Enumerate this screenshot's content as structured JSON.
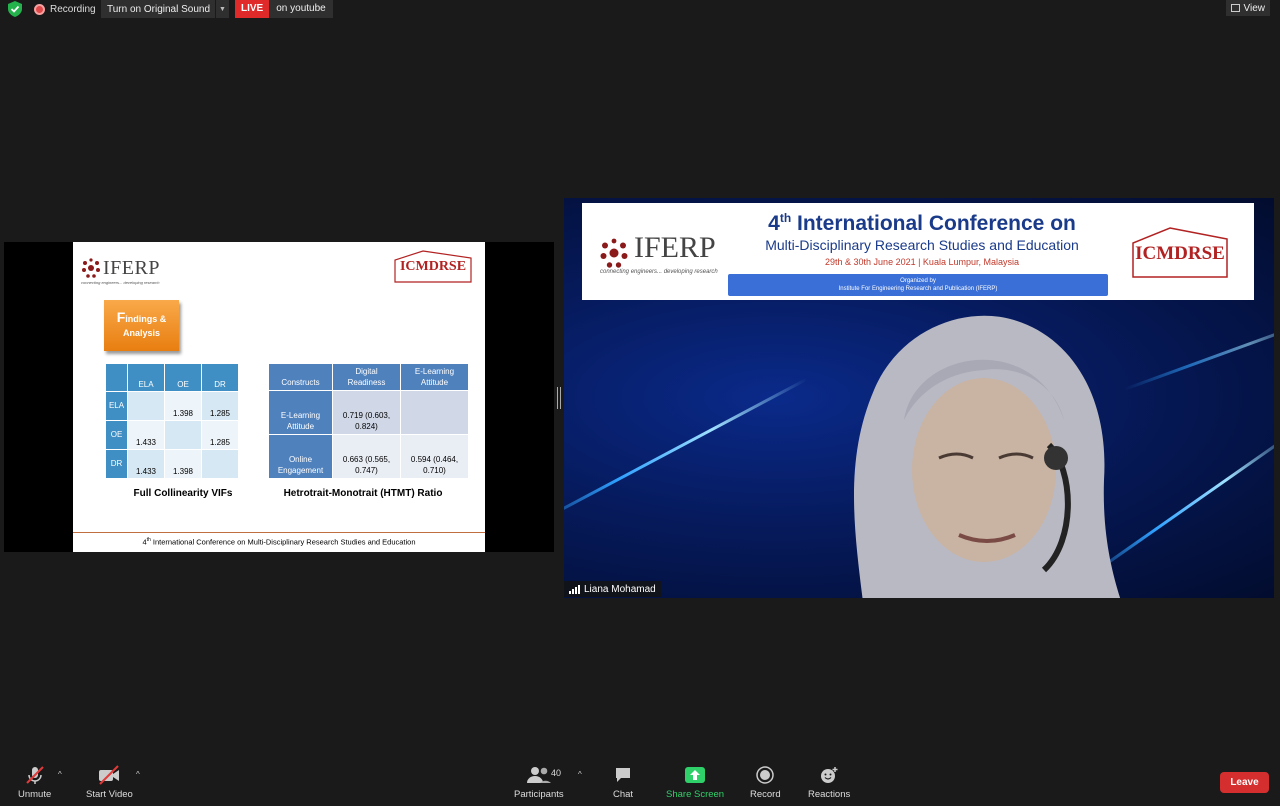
{
  "topbar": {
    "recording_label": "Recording",
    "original_sound_label": "Turn on Original Sound",
    "live_badge": "LIVE",
    "live_destination": "on youtube",
    "view_label": "View"
  },
  "shared_slide": {
    "iferp_word": "IFERP",
    "iferp_tagline": "connecting engineers... developing research",
    "icmdrse_logo": "ICMDRSE",
    "findings_title_first": "F",
    "findings_title_rest": "indings &",
    "findings_title_line2": "Analysis",
    "vif_table": {
      "headers": [
        "",
        "ELA",
        "OE",
        "DR"
      ],
      "rows": [
        [
          "ELA",
          "",
          "1.398",
          "1.285"
        ],
        [
          "OE",
          "1.433",
          "",
          "1.285"
        ],
        [
          "DR",
          "1.433",
          "1.398",
          ""
        ]
      ],
      "caption": "Full Collinearity VIFs"
    },
    "htmt_table": {
      "headers": [
        "Constructs",
        "Digital Readiness",
        "E-Learning Attitude"
      ],
      "rows": [
        [
          "E-Learning Attitude",
          "0.719 (0.603, 0.824)",
          ""
        ],
        [
          "Online Engagement",
          "0.663 (0.565, 0.747)",
          "0.594 (0.464, 0.710)"
        ]
      ],
      "caption": "Hetrotrait-Monotrait (HTMT) Ratio"
    },
    "footer_sup": "th",
    "footer_num": "4",
    "footer_text": " International Conference on Multi-Disciplinary Research Studies and Education"
  },
  "video_tile": {
    "banner": {
      "iferp_word": "IFERP",
      "iferp_tagline": "connecting engineers... developing research",
      "title_num": "4",
      "title_sup": "th",
      "title_rest": " International Conference on",
      "subtitle": "Multi-Disciplinary Research Studies and Education",
      "dates_location": "29th & 30th June 2021 | Kuala Lumpur, Malaysia",
      "organized_by": "Organized by",
      "organizer": "Institute For Engineering Research and Publication (IFERP)",
      "icmdrse_logo": "ICMDRSE"
    },
    "participant_name": "Liana Mohamad"
  },
  "toolbar": {
    "unmute_label": "Unmute",
    "start_video_label": "Start Video",
    "participants_label": "Participants",
    "participants_count": "40",
    "chat_label": "Chat",
    "share_screen_label": "Share Screen",
    "record_label": "Record",
    "reactions_label": "Reactions",
    "leave_label": "Leave"
  },
  "colors": {
    "live_red": "#e02a2a",
    "share_green": "#2fd06a",
    "leave_red": "#d42e2e",
    "findings_orange": "#e87e10",
    "table_blue": "#4f81bd"
  }
}
